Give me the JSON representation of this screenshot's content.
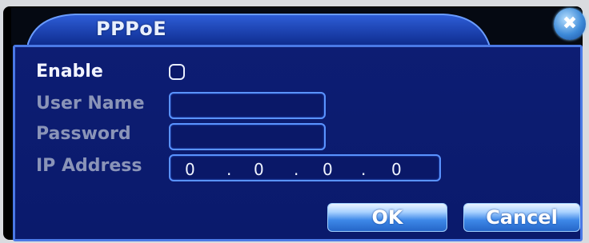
{
  "dialog": {
    "title": "PPPoE",
    "close_symbol": "✖"
  },
  "form": {
    "enable_label": "Enable",
    "enable_checked": false,
    "username_label": "User Name",
    "username_value": "",
    "password_label": "Password",
    "password_value": "",
    "ip_label": "IP Address",
    "ip_octets": [
      "0",
      "0",
      "0",
      "0"
    ]
  },
  "buttons": {
    "ok_label": "OK",
    "cancel_label": "Cancel"
  },
  "colors": {
    "panel": "#0d1d73",
    "border": "#4a79e6",
    "button": "#3e88e8"
  }
}
